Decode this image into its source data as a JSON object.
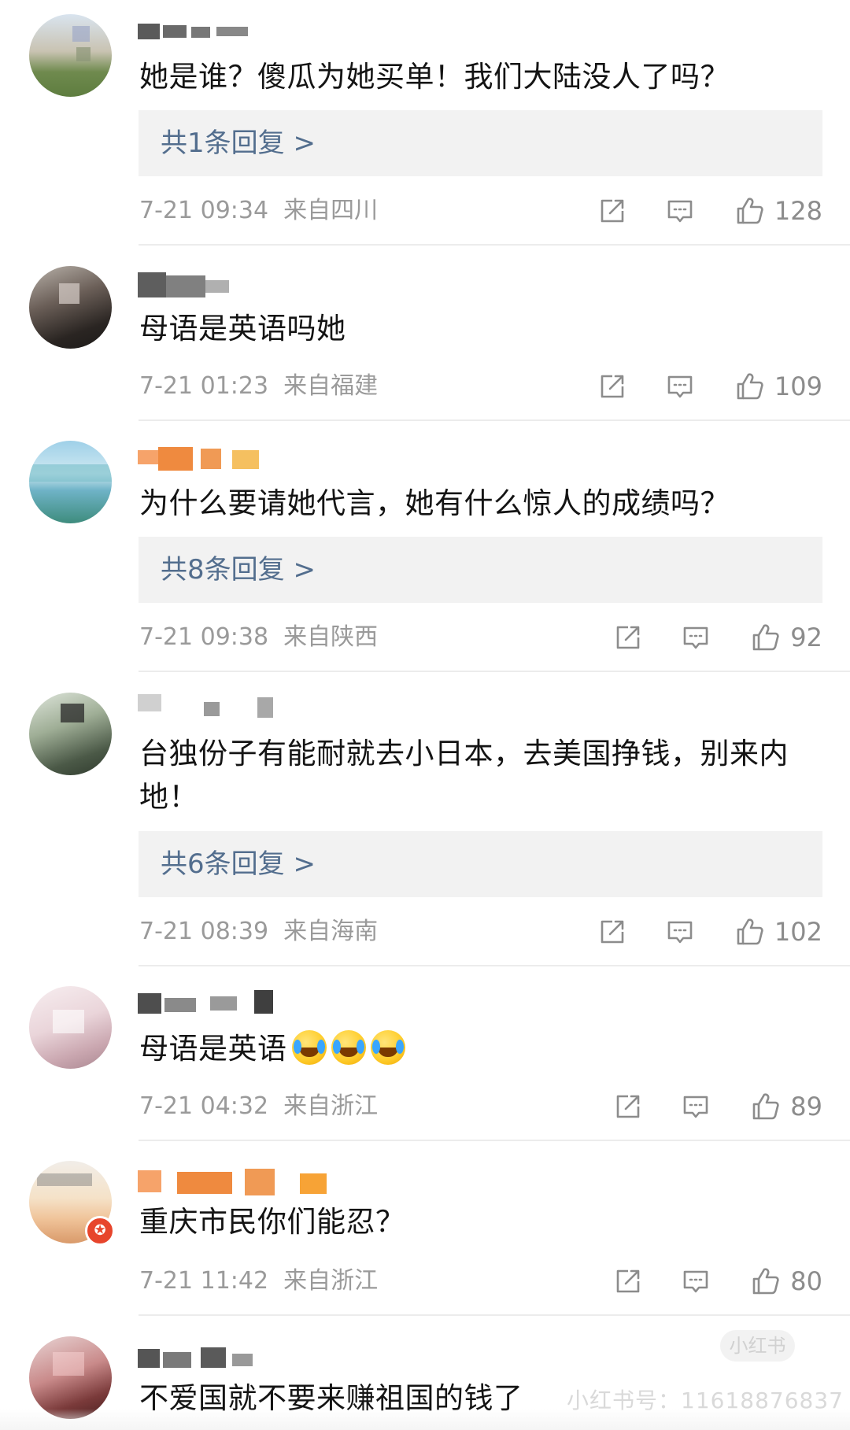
{
  "colors": {
    "reply_link": "#536e8e",
    "meta_text": "#9a9a9a",
    "reply_box_bg": "#f2f2f2",
    "divider": "#ececec"
  },
  "actions": {
    "share_icon": "share-icon",
    "comment_icon": "comment-icon",
    "like_icon": "thumbs-up-icon"
  },
  "comments": [
    {
      "text": "她是谁？傻瓜为她买单！我们大陆没人了吗？",
      "reply_label": "共1条回复 >",
      "time": "7-21 09:34",
      "location": "来自四川",
      "likes": "128"
    },
    {
      "text": "母语是英语吗她",
      "time": "7-21 01:23",
      "location": "来自福建",
      "likes": "109"
    },
    {
      "text": "为什么要请她代言，她有什么惊人的成绩吗？",
      "reply_label": "共8条回复 >",
      "time": "7-21 09:38",
      "location": "来自陕西",
      "likes": "92"
    },
    {
      "text_line1": "台独份子有能耐就去小日本，去美国挣钱，别来内",
      "text_line2": "地！",
      "reply_label": "共6条回复 >",
      "time": "7-21 08:39",
      "location": "来自海南",
      "likes": "102"
    },
    {
      "text": "母语是英语",
      "emoji": "laughing-crying-emoji",
      "time": "7-21 04:32",
      "location": "来自浙江",
      "likes": "89"
    },
    {
      "text": "重庆市民你们能忍？",
      "time": "7-21 11:42",
      "location": "来自浙江",
      "likes": "80"
    },
    {
      "text": "不爱国就不要来赚祖国的钱了"
    }
  ],
  "watermark": {
    "text": "小红书号：11618876837",
    "logo": "小红书"
  }
}
